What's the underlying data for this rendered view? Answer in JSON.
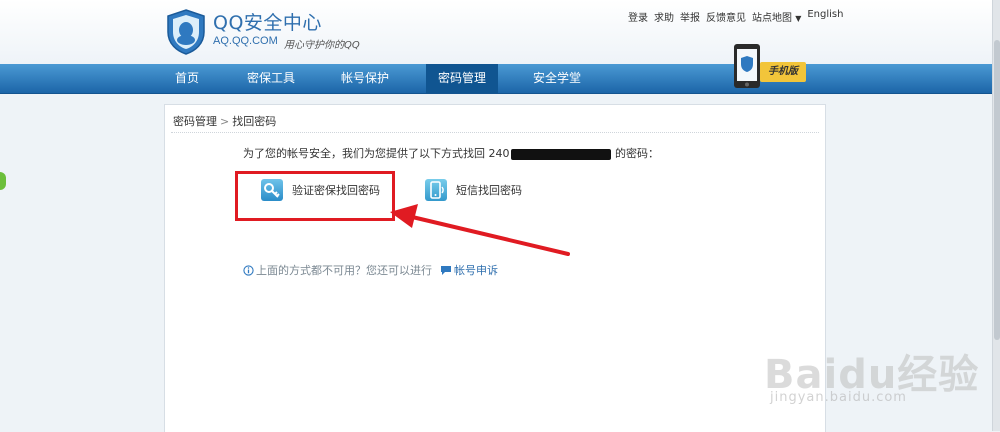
{
  "header": {
    "title": "QQ安全中心",
    "domain": "AQ.QQ.COM",
    "slogan": "用心守护你的QQ",
    "links": [
      "登录",
      "求助",
      "举报",
      "反馈意见",
      "站点地图",
      "English"
    ]
  },
  "nav": {
    "items": [
      "首页",
      "密保工具",
      "帐号保护",
      "密码管理",
      "安全学堂"
    ],
    "active": "密码管理",
    "mobile_label": "手机版"
  },
  "breadcrumb": [
    "密码管理",
    "找回密码"
  ],
  "intro": {
    "prefix": "为了您的帐号安全，我们为您提供了以下方式找回 ",
    "masked_visible": "240",
    "suffix": " 的密码："
  },
  "methods": [
    {
      "label": "验证密保找回密码",
      "icon": "key-icon"
    },
    {
      "label": "短信找回密码",
      "icon": "phone-sms-icon"
    }
  ],
  "help": {
    "text": "上面的方式都不可用？您还可以进行",
    "link": "帐号申诉"
  },
  "watermark": {
    "brand": "Baidu经验",
    "url": "jingyan.baidu.com"
  },
  "colors": {
    "nav_bg": "#1c65a8",
    "nav_active": "#105591",
    "highlight": "#e01b22",
    "link": "#2f6fae"
  }
}
